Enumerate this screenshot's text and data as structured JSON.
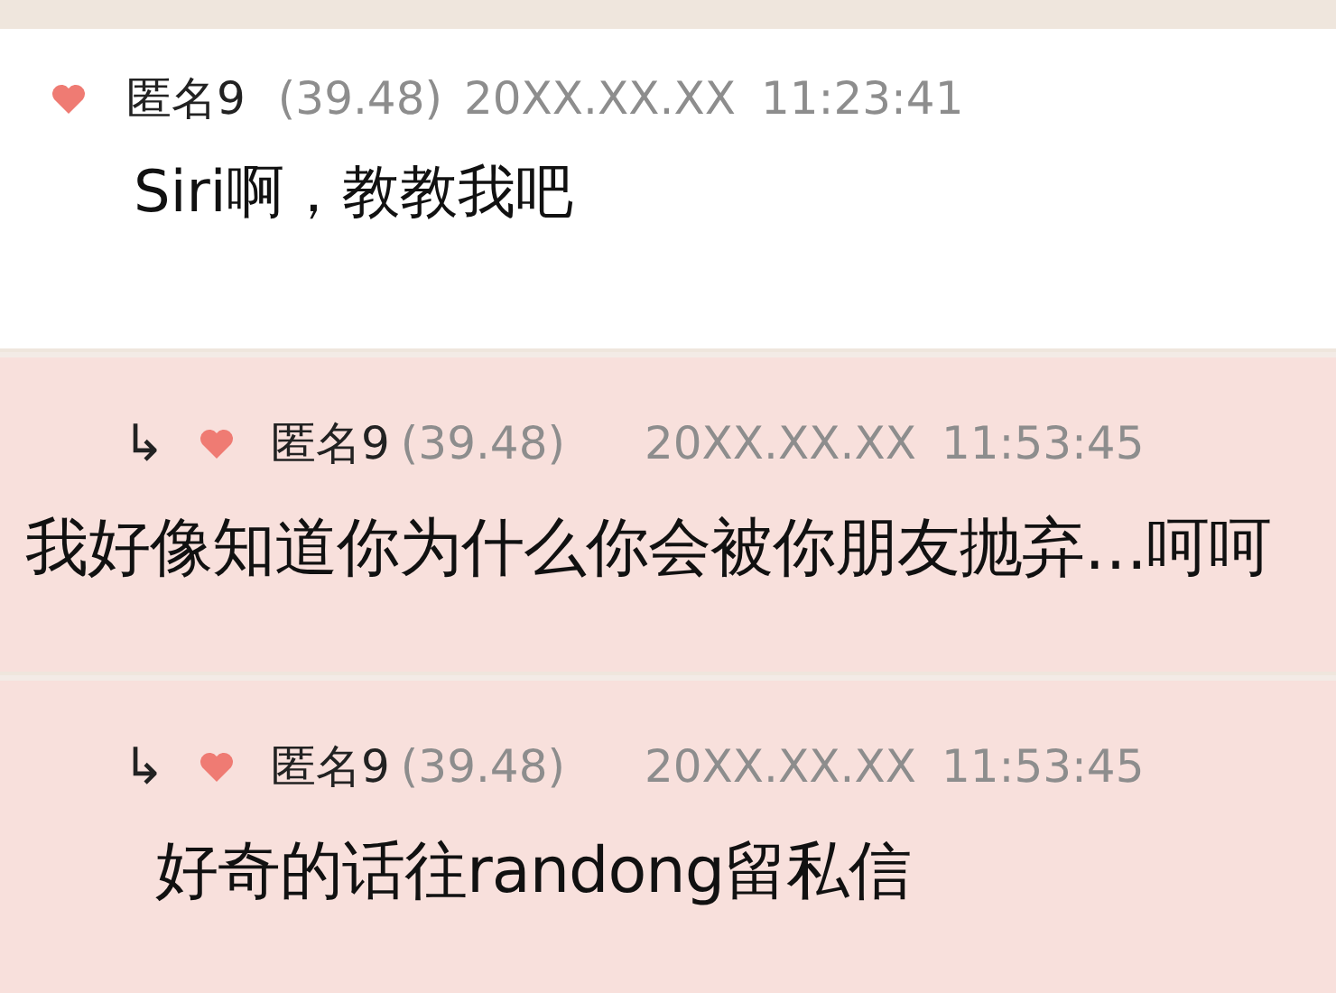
{
  "comments": [
    {
      "kind": "comment",
      "name": "匿名9",
      "score": "(39.48)",
      "date": "20XX.XX.XX",
      "time": "11:23:41",
      "text": "Siri啊，教教我吧"
    },
    {
      "kind": "reply",
      "reply_mark": "↳",
      "name": "匿名9",
      "score": "(39.48)",
      "date": "20XX.XX.XX",
      "time": "11:53:45",
      "text": "我好像知道你为什么你会被你朋友抛弃…呵呵"
    },
    {
      "kind": "reply",
      "reply_mark": "↳",
      "name": "匿名9",
      "score": "(39.48)",
      "date": "20XX.XX.XX",
      "time": "11:53:45",
      "text": "好奇的话往randong留私信"
    }
  ]
}
